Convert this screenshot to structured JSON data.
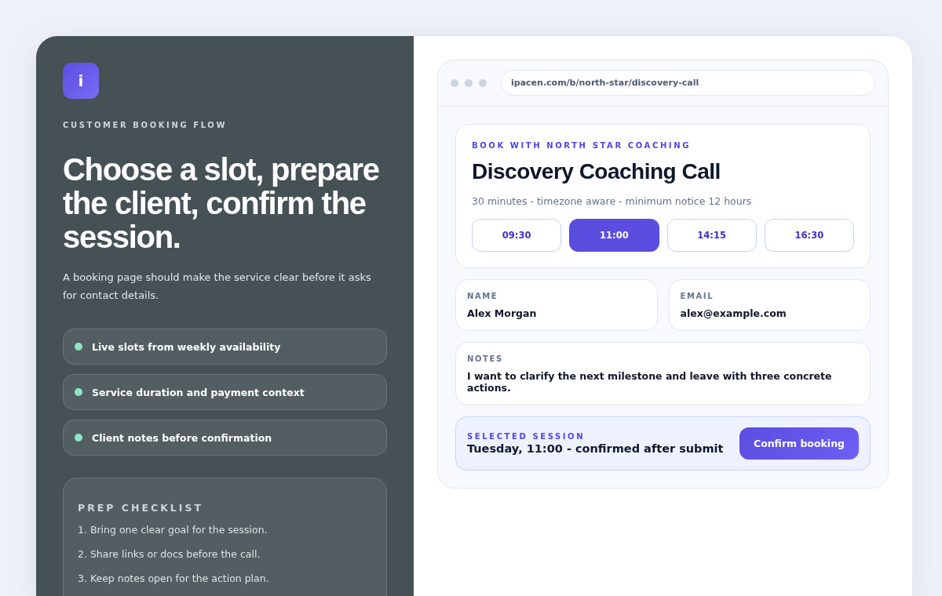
{
  "logo": {
    "letter": "i"
  },
  "hero": {
    "eyebrow": "CUSTOMER BOOKING FLOW",
    "title": "Choose a slot, prepare the client, confirm the session.",
    "description": "A booking page should make the service clear before it asks for contact details."
  },
  "features": [
    {
      "label": "Live slots from weekly availability"
    },
    {
      "label": "Service duration and payment context"
    },
    {
      "label": "Client notes before confirmation"
    }
  ],
  "checklist": {
    "title": "PREP CHECKLIST",
    "items": [
      "1. Bring one clear goal for the session.",
      "2. Share links or docs before the call.",
      "3. Keep notes open for the action plan."
    ]
  },
  "browser": {
    "url": "ipacen.com/b/north-star/discovery-call"
  },
  "service": {
    "eyebrow": "BOOK WITH NORTH STAR COACHING",
    "title": "Discovery Coaching Call",
    "meta": "30 minutes - timezone aware - minimum notice 12 hours",
    "slots": [
      {
        "time": "09:30",
        "selected": false
      },
      {
        "time": "11:00",
        "selected": true
      },
      {
        "time": "14:15",
        "selected": false
      },
      {
        "time": "16:30",
        "selected": false
      }
    ]
  },
  "form": {
    "fields": [
      {
        "label": "NAME",
        "value": "Alex Morgan",
        "kind": "half"
      },
      {
        "label": "EMAIL",
        "value": "alex@example.com",
        "kind": "half"
      },
      {
        "label": "NOTES",
        "value": "I want to clarify the next milestone and leave with three concrete actions.",
        "kind": "full"
      }
    ]
  },
  "summary": {
    "label": "SELECTED SESSION",
    "value": "Tuesday, 11:00 - confirmed after submit",
    "button": "Confirm booking"
  }
}
